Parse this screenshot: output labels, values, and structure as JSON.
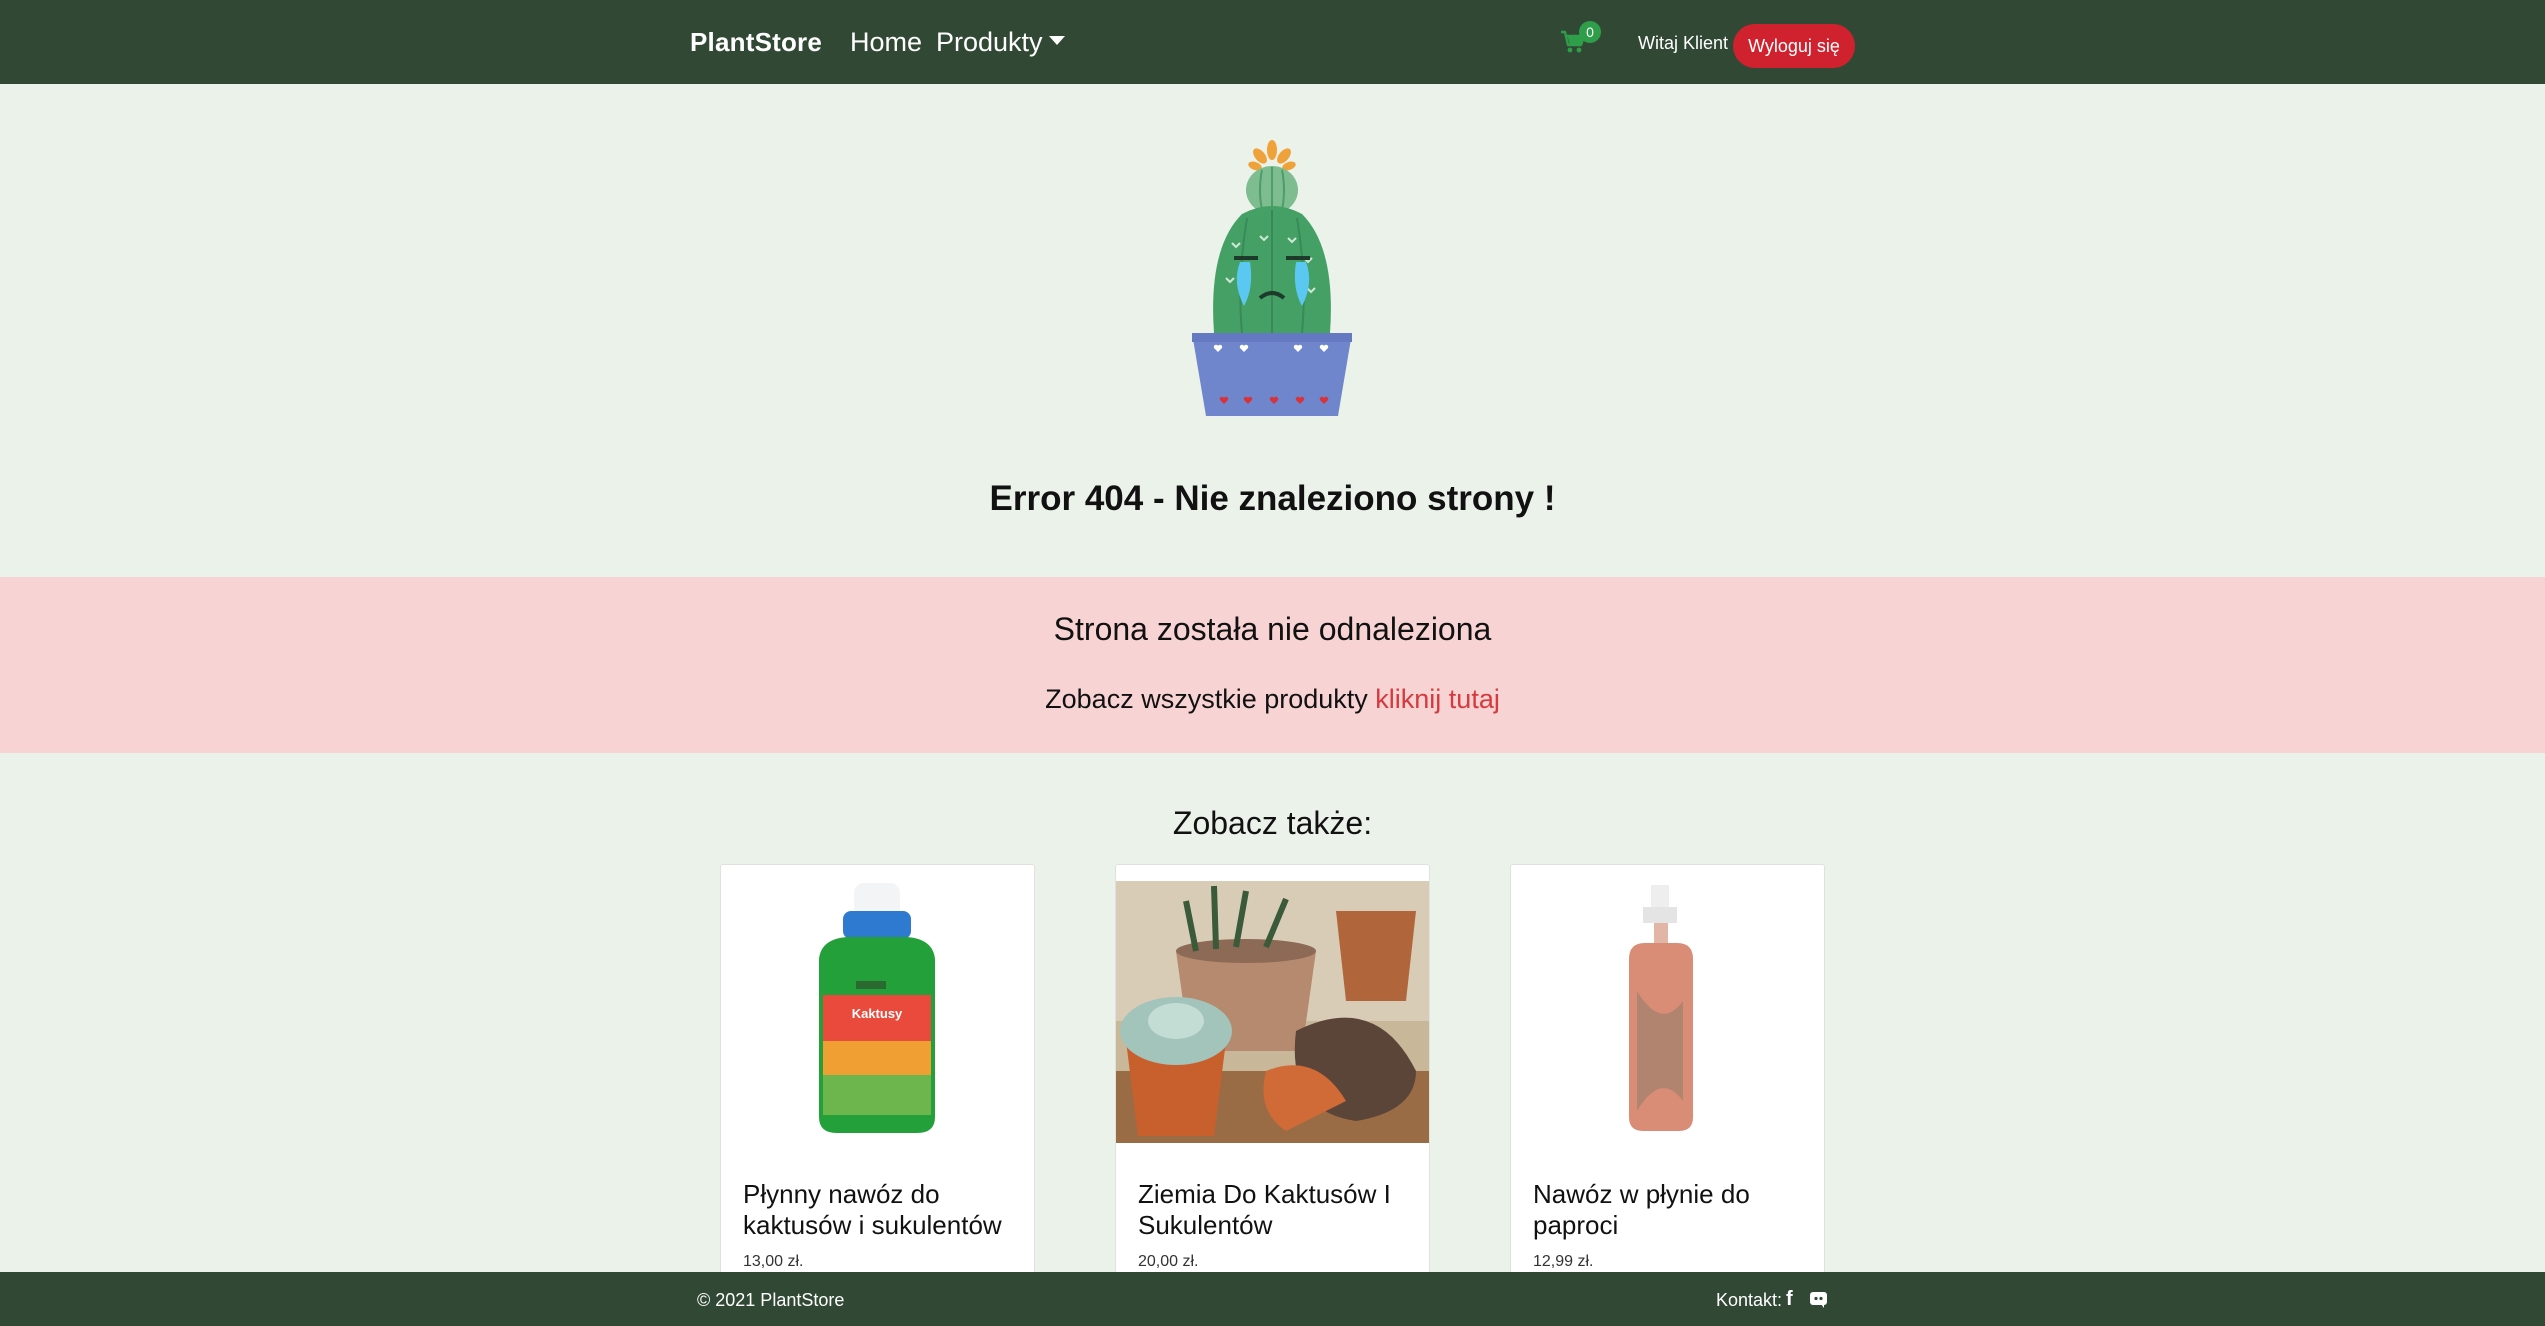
{
  "navbar": {
    "brand": "PlantStore",
    "home_label": "Home",
    "products_label": "Produkty",
    "cart_count": "0",
    "welcome_text": "Witaj Klient",
    "logout_label": "Wyloguj się",
    "background_color": "#314934",
    "logout_color": "#d0222e"
  },
  "error": {
    "title": "Error 404 - Nie znaleziono strony !"
  },
  "alert": {
    "heading": "Strona została nie odnaleziona",
    "text": "Zobacz wszystkie produkty",
    "link_label": "kliknij tutaj",
    "background_color": "#f8d3d4",
    "link_color": "#d53a3e"
  },
  "see_also": {
    "title": "Zobacz także:",
    "products": [
      {
        "name": "Płynny nawóz do kaktusów i sukulentów",
        "price": "13,00 zł."
      },
      {
        "name": "Ziemia Do Kaktusów I Sukulentów",
        "price": "20,00 zł."
      },
      {
        "name": "Nawóz w płynie do paproci",
        "price": "12,99 zł."
      }
    ]
  },
  "footer": {
    "copyright": "© 2021 PlantStore",
    "contact_label": "Kontakt:",
    "icons": [
      "facebook-icon",
      "discord-icon"
    ]
  }
}
